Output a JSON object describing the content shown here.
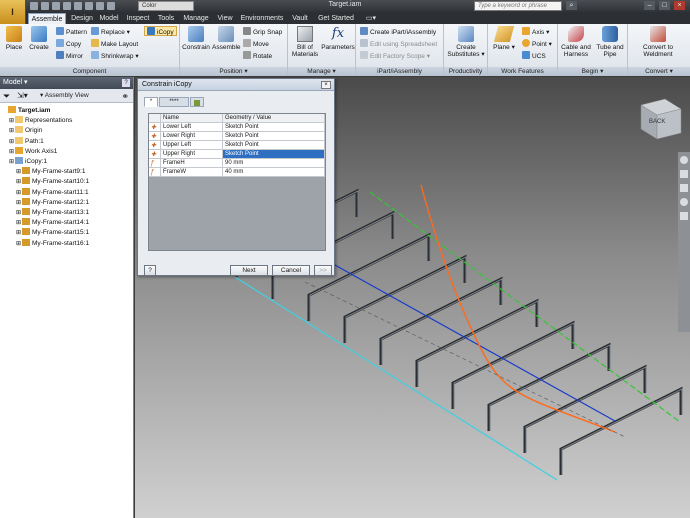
{
  "title_bar": {
    "document_title": "Target.iam",
    "color_combo": "Color",
    "search_placeholder": "Type a keyword or phrase"
  },
  "tabs": [
    "Assemble",
    "Design",
    "Model",
    "Inspect",
    "Tools",
    "Manage",
    "View",
    "Environments",
    "Vault",
    "Get Started"
  ],
  "active_tab": "Assemble",
  "ribbon": {
    "component": {
      "title": "Component",
      "place": "Place",
      "create": "Create",
      "pattern": "Pattern",
      "copy": "Copy",
      "mirror": "Mirror",
      "replace": "Replace",
      "make_layout": "Make Layout",
      "shrinkwrap": "Shrinkwrap",
      "icopy": "iCopy"
    },
    "position": {
      "title": "Position",
      "constrain": "Constrain",
      "assemble": "Assemble",
      "grip_snap": "Grip Snap",
      "move": "Move",
      "rotate": "Rotate"
    },
    "manage": {
      "title": "Manage",
      "bill_of_materials_line1": "Bill of",
      "bill_of_materials_line2": "Materials",
      "parameters": "Parameters"
    },
    "ipart": {
      "title": "iPart/iAssembly",
      "create": "Create iPart/iAssembly",
      "edit_spreadsheet": "Edit using Spreadsheet",
      "edit_factory": "Edit Factory Scope"
    },
    "productivity": {
      "title": "Productivity",
      "create_substitutes_line1": "Create",
      "create_substitutes_line2": "Substitutes"
    },
    "work_features": {
      "title": "Work Features",
      "plane": "Plane",
      "axis": "Axis",
      "point": "Point",
      "ucs": "UCS"
    },
    "begin": {
      "title": "Begin",
      "cable_line1": "Cable and",
      "cable_line2": "Harness",
      "tube_line1": "Tube and",
      "tube_line2": "Pipe"
    },
    "convert": {
      "title": "Convert",
      "weldment_line1": "Convert to",
      "weldment_line2": "Weldment"
    }
  },
  "browser": {
    "header": "Model",
    "view_label": "Assembly View",
    "items": [
      {
        "label": "Target.iam",
        "level": 0
      },
      {
        "label": "Representations",
        "level": 1
      },
      {
        "label": "Origin",
        "level": 1
      },
      {
        "label": "Path:1",
        "level": 1
      },
      {
        "label": "Work Axis1",
        "level": 1
      },
      {
        "label": "iCopy:1",
        "level": 1
      },
      {
        "label": "My-Frame-start9:1",
        "level": 2
      },
      {
        "label": "My-Frame-start10:1",
        "level": 2
      },
      {
        "label": "My-Frame-start11:1",
        "level": 2
      },
      {
        "label": "My-Frame-start12:1",
        "level": 2
      },
      {
        "label": "My-Frame-start13:1",
        "level": 2
      },
      {
        "label": "My-Frame-start14:1",
        "level": 2
      },
      {
        "label": "My-Frame-start15:1",
        "level": 2
      },
      {
        "label": "My-Frame-start16:1",
        "level": 2
      }
    ]
  },
  "dialog": {
    "title": "Constrain iCopy",
    "tabs": [
      "*",
      "****",
      ""
    ],
    "columns": [
      "Name",
      "Geometry / Value"
    ],
    "rows": [
      {
        "name": "Lower Left",
        "value": "Sketch Point"
      },
      {
        "name": "Lower Right",
        "value": "Sketch Point"
      },
      {
        "name": "Upper Left",
        "value": "Sketch Point"
      },
      {
        "name": "Upper Right",
        "value": "Sketch Point"
      },
      {
        "name": "FrameH",
        "value": "90 mm"
      },
      {
        "name": "FrameW",
        "value": "40 mm"
      }
    ],
    "next": "Next",
    "cancel": "Cancel",
    "forward": ">>",
    "help": "?"
  },
  "viewcube_label": "BACK",
  "colors": {
    "accent": "#2f6fc1",
    "path_orange": "#ff6a1a",
    "axis_blue": "#1a3dc8",
    "axis_green": "#32c832",
    "axis_cyan": "#3fd0e0"
  }
}
